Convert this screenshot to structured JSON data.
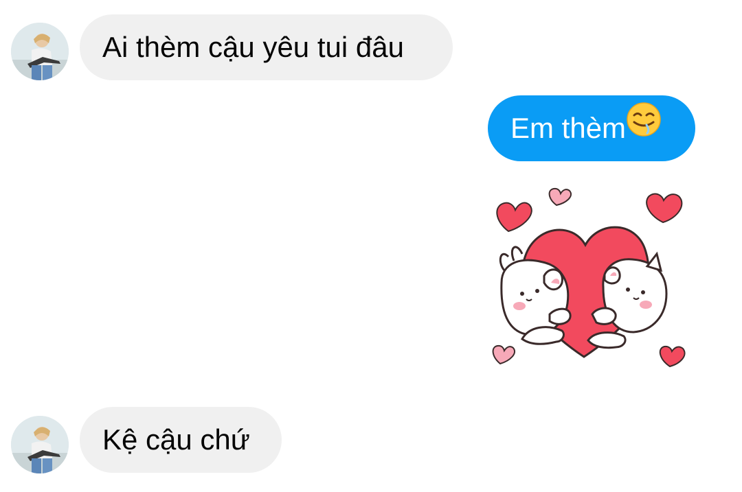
{
  "conversation": {
    "messages": [
      {
        "direction": "incoming",
        "text": "Ai thèm cậu yêu tui đâu"
      },
      {
        "direction": "outgoing",
        "text": "Em thèm",
        "emoji": "drooling-face-emoji"
      },
      {
        "direction": "outgoing",
        "sticker": "bunnies-hugging-heart-sticker"
      },
      {
        "direction": "incoming",
        "text": "Kệ cậu chứ"
      }
    ]
  },
  "colors": {
    "outgoing_bubble": "#0a9cf5",
    "incoming_bubble": "#f0f0f0",
    "heart": "#f24a5e",
    "pink_heart": "#f7a9b8"
  }
}
